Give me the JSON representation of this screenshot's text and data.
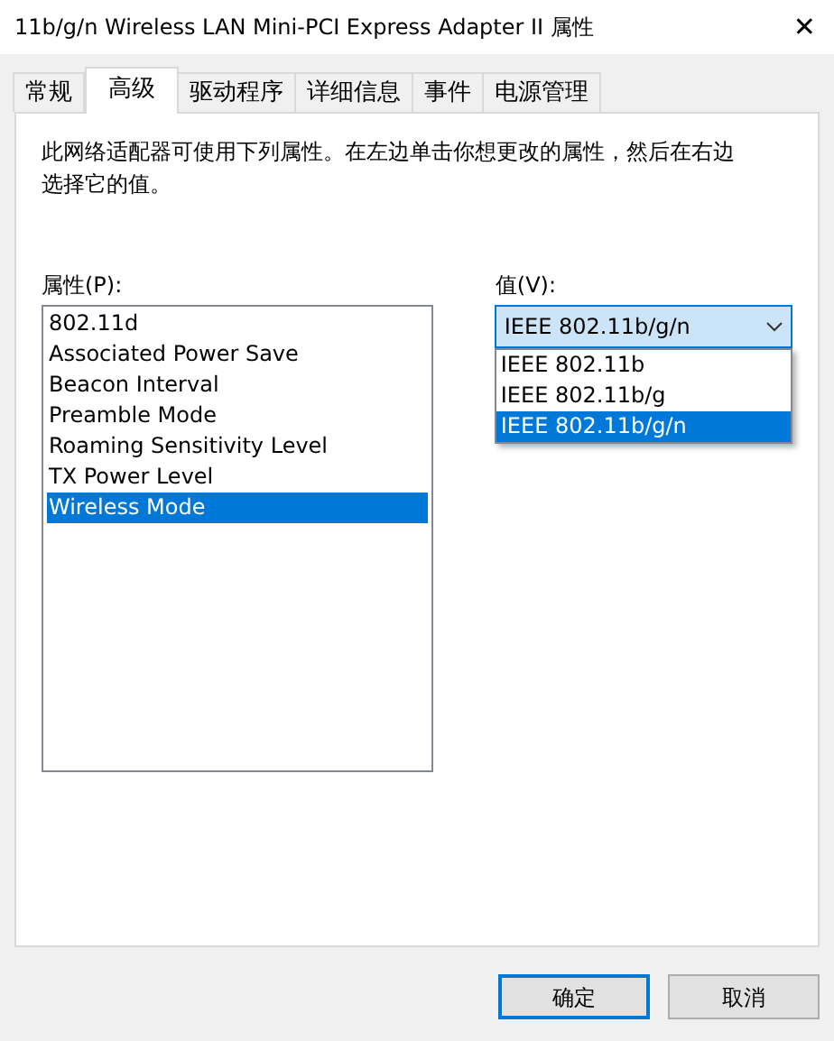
{
  "window": {
    "title": "11b/g/n  Wireless LAN Mini-PCI Express Adapter II 属性",
    "close": "✕"
  },
  "tabs": [
    {
      "label": "常规",
      "selected": false
    },
    {
      "label": "高级",
      "selected": true
    },
    {
      "label": "驱动程序",
      "selected": false
    },
    {
      "label": "详细信息",
      "selected": false
    },
    {
      "label": "事件",
      "selected": false
    },
    {
      "label": "电源管理",
      "selected": false
    }
  ],
  "description": "此网络适配器可使用下列属性。在左边单击你想更改的属性，然后在右边选择它的值。",
  "properties": {
    "label": "属性(P):",
    "items": [
      {
        "label": "802.11d",
        "selected": false
      },
      {
        "label": "Associated Power Save",
        "selected": false
      },
      {
        "label": "Beacon Interval",
        "selected": false
      },
      {
        "label": "Preamble Mode",
        "selected": false
      },
      {
        "label": "Roaming Sensitivity Level",
        "selected": false
      },
      {
        "label": "TX Power Level",
        "selected": false
      },
      {
        "label": "Wireless Mode",
        "selected": true
      }
    ]
  },
  "value": {
    "label": "值(V):",
    "current": "IEEE 802.11b/g/n",
    "expanded": true,
    "options": [
      {
        "label": "IEEE 802.11b",
        "selected": false
      },
      {
        "label": "IEEE 802.11b/g",
        "selected": false
      },
      {
        "label": "IEEE 802.11b/g/n",
        "selected": true
      }
    ]
  },
  "buttons": [
    {
      "label": "确定",
      "default": true
    },
    {
      "label": "取消",
      "default": false
    }
  ]
}
